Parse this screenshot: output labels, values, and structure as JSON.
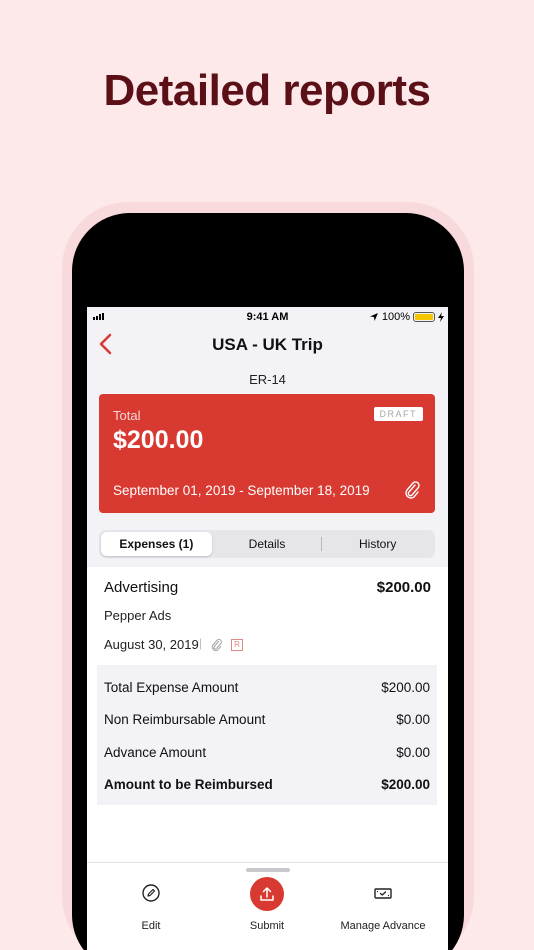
{
  "headline": "Detailed reports",
  "status_bar": {
    "time": "9:41 AM",
    "battery": "100%"
  },
  "nav": {
    "title": "USA - UK Trip"
  },
  "report_id": "ER-14",
  "card": {
    "label": "Total",
    "amount": "$200.00",
    "badge": "DRAFT",
    "dates": "September 01, 2019 - September 18, 2019"
  },
  "tabs": [
    {
      "label": "Expenses (1)",
      "active": true
    },
    {
      "label": "Details",
      "active": false
    },
    {
      "label": "History",
      "active": false
    }
  ],
  "expense": {
    "title": "Advertising",
    "amount": "$200.00",
    "merchant": "Pepper Ads",
    "date": "August 30, 2019",
    "pipe": "|",
    "receipt_badge": "R"
  },
  "summary": [
    {
      "label": "Total Expense Amount",
      "value": "$200.00"
    },
    {
      "label": "Non Reimbursable Amount",
      "value": "$0.00"
    },
    {
      "label": "Advance Amount",
      "value": "$0.00"
    },
    {
      "label": "Amount to be Reimbursed",
      "value": "$200.00"
    }
  ],
  "actions": {
    "edit": "Edit",
    "submit": "Submit",
    "manage_advance": "Manage Advance"
  },
  "colors": {
    "accent": "#d83a32",
    "background": "#fde9ea",
    "headline": "#5b0f17"
  }
}
